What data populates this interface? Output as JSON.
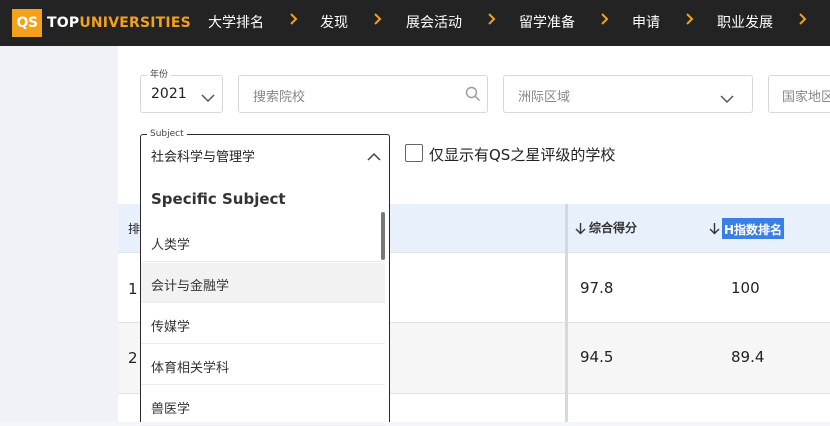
{
  "brand": {
    "qs": "QS",
    "top": "TOP",
    "universities": "UNIVERSITIES"
  },
  "nav": {
    "items": [
      "大学排名",
      "发现",
      "展会活动",
      "留学准备",
      "申请",
      "职业发展"
    ],
    "accent_color": "#f3a01b",
    "chevron_icon": "chevron-right-icon"
  },
  "filters": {
    "year": {
      "label": "年份",
      "value": "2021"
    },
    "search": {
      "placeholder": "搜索院校"
    },
    "region": {
      "placeholder": "洲际区域"
    },
    "country": {
      "placeholder": "国家地区"
    },
    "subject": {
      "label": "Subject",
      "value": "社会科学与管理学"
    },
    "qs_stars_only": {
      "label": "仅显示有QS之星评级的学校",
      "checked": false
    }
  },
  "table": {
    "columns": {
      "rank": "排",
      "overall": "综合得分",
      "h_index": "H指数排名"
    },
    "rows": [
      {
        "rank": "1",
        "overall": "97.8",
        "h_index": "100"
      },
      {
        "rank": "2",
        "overall": "94.5",
        "h_index": "89.4"
      }
    ]
  },
  "dropdown": {
    "heading": "Specific Subject",
    "options": [
      "人类学",
      "会计与金融学",
      "传媒学",
      "体育相关学科",
      "兽医学"
    ],
    "hovered_index": 1
  }
}
